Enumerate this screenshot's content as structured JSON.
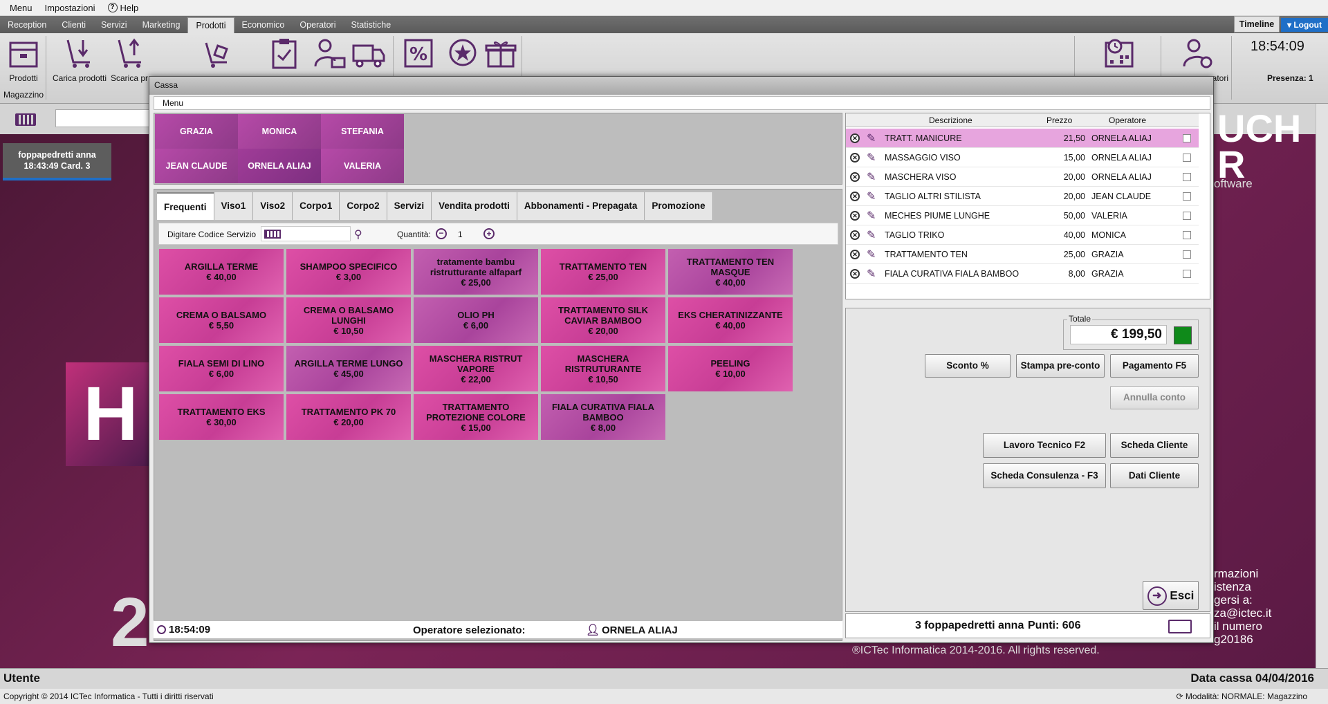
{
  "menubar": {
    "items": [
      "Menu",
      "Impostazioni",
      "Help"
    ]
  },
  "tabs": [
    "Reception",
    "Clienti",
    "Servizi",
    "Marketing",
    "Prodotti",
    "Economico",
    "Operatori",
    "Statistiche"
  ],
  "active_tab": "Prodotti",
  "timeline": "Timeline",
  "logout": "Logout",
  "ribbon": {
    "prodotti": "Prodotti",
    "carica": "Carica prodotti",
    "scarica": "Scarica pr",
    "group": "Magazzino",
    "clock": "18:54:09",
    "operatori": "eratori",
    "presenza": "Presenza: 1"
  },
  "customer_card": {
    "name": "foppapedretti  anna",
    "time": "18:43:49 Card. 3"
  },
  "background": {
    "big_letter": "H",
    "year": "2",
    "brand_line1": "UCH",
    "brand_line2": "R",
    "brand_sw": "oftware",
    "info": [
      "rmazioni",
      "istenza",
      "gersi a:",
      "za@ictec.it",
      "il numero",
      "g20186"
    ],
    "copyright": "®ICTec Informatica 2014-2016. All rights reserved."
  },
  "status": {
    "left": "Utente",
    "right": "Data cassa 04/04/2016"
  },
  "footer": {
    "left": "Copyright © 2014 ICTec Informatica - Tutti i diritti riservati",
    "right": "Modalità: NORMALE: Magazzino"
  },
  "cassa": {
    "title": "Cassa",
    "menu": "Menu",
    "operators": [
      "GRAZIA",
      "MONICA",
      "STEFANIA",
      "JEAN CLAUDE",
      "ORNELA ALIAJ",
      "VALERIA"
    ],
    "cat_tabs": [
      "Frequenti",
      "Viso1",
      "Viso2",
      "Corpo1",
      "Corpo2",
      "Servizi",
      "Vendita prodotti",
      "Abbonamenti - Prepagata",
      "Promozione"
    ],
    "code_label": "Digitare Codice Servizio",
    "qty_label": "Quantità:",
    "qty": "1",
    "services": [
      {
        "name": "ARGILLA TERME",
        "price": "€ 40,00"
      },
      {
        "name": "SHAMPOO SPECIFICO",
        "price": "€ 3,00"
      },
      {
        "name": "tratamente bambu ristrutturante alfaparf",
        "price": "€ 25,00"
      },
      {
        "name": "TRATTAMENTO  TEN",
        "price": "€ 25,00"
      },
      {
        "name": "TRATTAMENTO TEN MASQUE",
        "price": "€ 40,00"
      },
      {
        "name": "CREMA O BALSAMO",
        "price": "€ 5,50"
      },
      {
        "name": "CREMA O BALSAMO LUNGHI",
        "price": "€ 10,50"
      },
      {
        "name": "OLIO PH",
        "price": "€ 6,00"
      },
      {
        "name": "TRATTAMENTO SILK CAVIAR  BAMBOO",
        "price": "€ 20,00"
      },
      {
        "name": "EKS CHERATINIZZANTE",
        "price": "€ 40,00"
      },
      {
        "name": "FIALA  SEMI DI LINO",
        "price": "€ 6,00"
      },
      {
        "name": "ARGILLA TERME LUNGO",
        "price": "€ 45,00"
      },
      {
        "name": "MASCHERA RISTRUT VAPORE",
        "price": "€ 22,00"
      },
      {
        "name": "MASCHERA RISTRUTURANTE",
        "price": "€ 10,50"
      },
      {
        "name": "PEELING",
        "price": "€ 10,00"
      },
      {
        "name": "TRATTAMENTO EKS",
        "price": "€ 30,00"
      },
      {
        "name": "TRATTAMENTO PK 70",
        "price": "€ 20,00"
      },
      {
        "name": "TRATTAMENTO PROTEZIONE COLORE",
        "price": "€ 15,00"
      },
      {
        "name": "FIALA CURATIVA FIALA BAMBOO",
        "price": "€ 8,00"
      }
    ],
    "bottom_time": "18:54:09",
    "bottom_label": "Operatore selezionato:",
    "bottom_operator": "ORNELA ALIAJ",
    "lines_header": {
      "desc": "Descrizione",
      "price": "Prezzo",
      "op": "Operatore"
    },
    "lines": [
      {
        "desc": "TRATT. MANICURE",
        "price": "21,50",
        "op": "ORNELA ALIAJ",
        "selected": true
      },
      {
        "desc": "MASSAGGIO VISO",
        "price": "15,00",
        "op": "ORNELA ALIAJ"
      },
      {
        "desc": "MASCHERA VISO",
        "price": "20,00",
        "op": "ORNELA ALIAJ"
      },
      {
        "desc": "TAGLIO ALTRI STILISTA",
        "price": "20,00",
        "op": "JEAN CLAUDE"
      },
      {
        "desc": "MECHES PIUME  LUNGHE",
        "price": "50,00",
        "op": "VALERIA"
      },
      {
        "desc": "TAGLIO TRIKO",
        "price": "40,00",
        "op": "MONICA"
      },
      {
        "desc": "TRATTAMENTO  TEN",
        "price": "25,00",
        "op": "GRAZIA"
      },
      {
        "desc": "FIALA CURATIVA FIALA BAMBOO",
        "price": "8,00",
        "op": "GRAZIA"
      }
    ],
    "totale_label": "Totale",
    "totale": "€ 199,50",
    "buttons": {
      "sconto": "Sconto %",
      "stampa": "Stampa pre-conto",
      "pagamento": "Pagamento F5",
      "annulla": "Annulla conto",
      "lavoro": "Lavoro Tecnico F2",
      "scheda_cliente": "Scheda Cliente",
      "scheda_cons": "Scheda Consulenza - F3",
      "dati": "Dati Cliente",
      "esci": "Esci"
    },
    "customer_line": "3 foppapedretti  anna",
    "points": "Punti: 606"
  },
  "colors": {
    "accent": "#1f6fc7",
    "selected_row": "#e7a5de",
    "total_indicator": "#0f8a1a"
  }
}
